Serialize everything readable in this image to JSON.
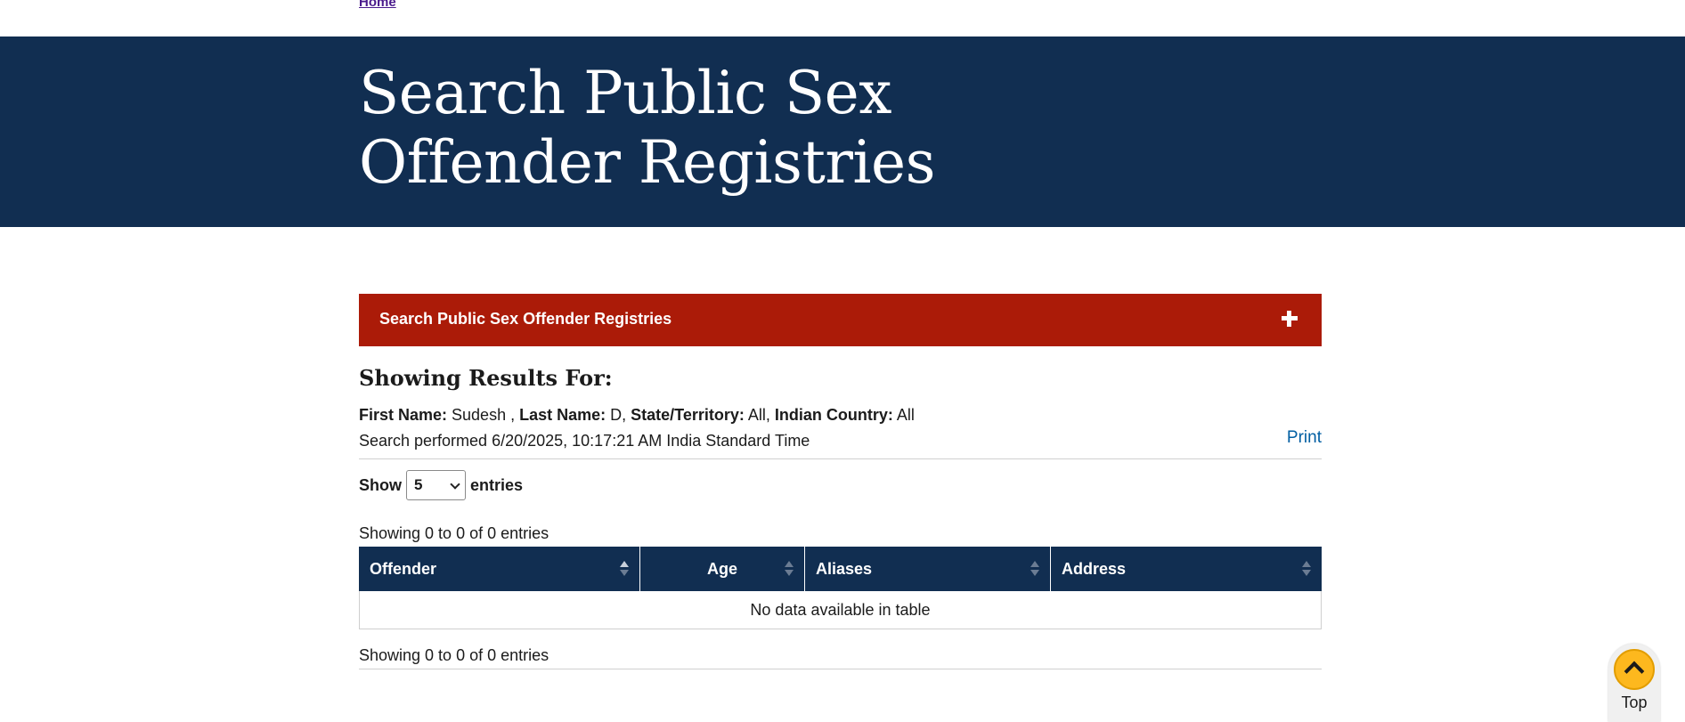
{
  "breadcrumb": {
    "home": "Home"
  },
  "hero": {
    "title": "Search Public Sex Offender Registries"
  },
  "accordion": {
    "label": "Search Public Sex Offender Registries"
  },
  "results": {
    "heading": "Showing Results For:",
    "first_name_label": "First Name:",
    "first_name_value": " Sudesh , ",
    "last_name_label": "Last Name:",
    "last_name_value": " D, ",
    "state_label": "State/Territory:",
    "state_value": " All, ",
    "indian_country_label": "Indian Country:",
    "indian_country_value": " All",
    "performed": "Search performed 6/20/2025, 10:17:21 AM India Standard Time",
    "print": "Print"
  },
  "length_control": {
    "show": "Show",
    "selected": "5",
    "entries": "entries"
  },
  "info_top": "Showing 0 to 0 of 0 entries",
  "table": {
    "columns": [
      "Offender",
      "Age",
      "Aliases",
      "Address"
    ],
    "empty": "No data available in table"
  },
  "info_bottom": "Showing 0 to 0 of 0 entries",
  "top_button": {
    "label": "Top"
  },
  "colors": {
    "navy": "#112e51",
    "red": "#ab1b08",
    "gold": "#fdb81e",
    "link": "#005ea2"
  }
}
